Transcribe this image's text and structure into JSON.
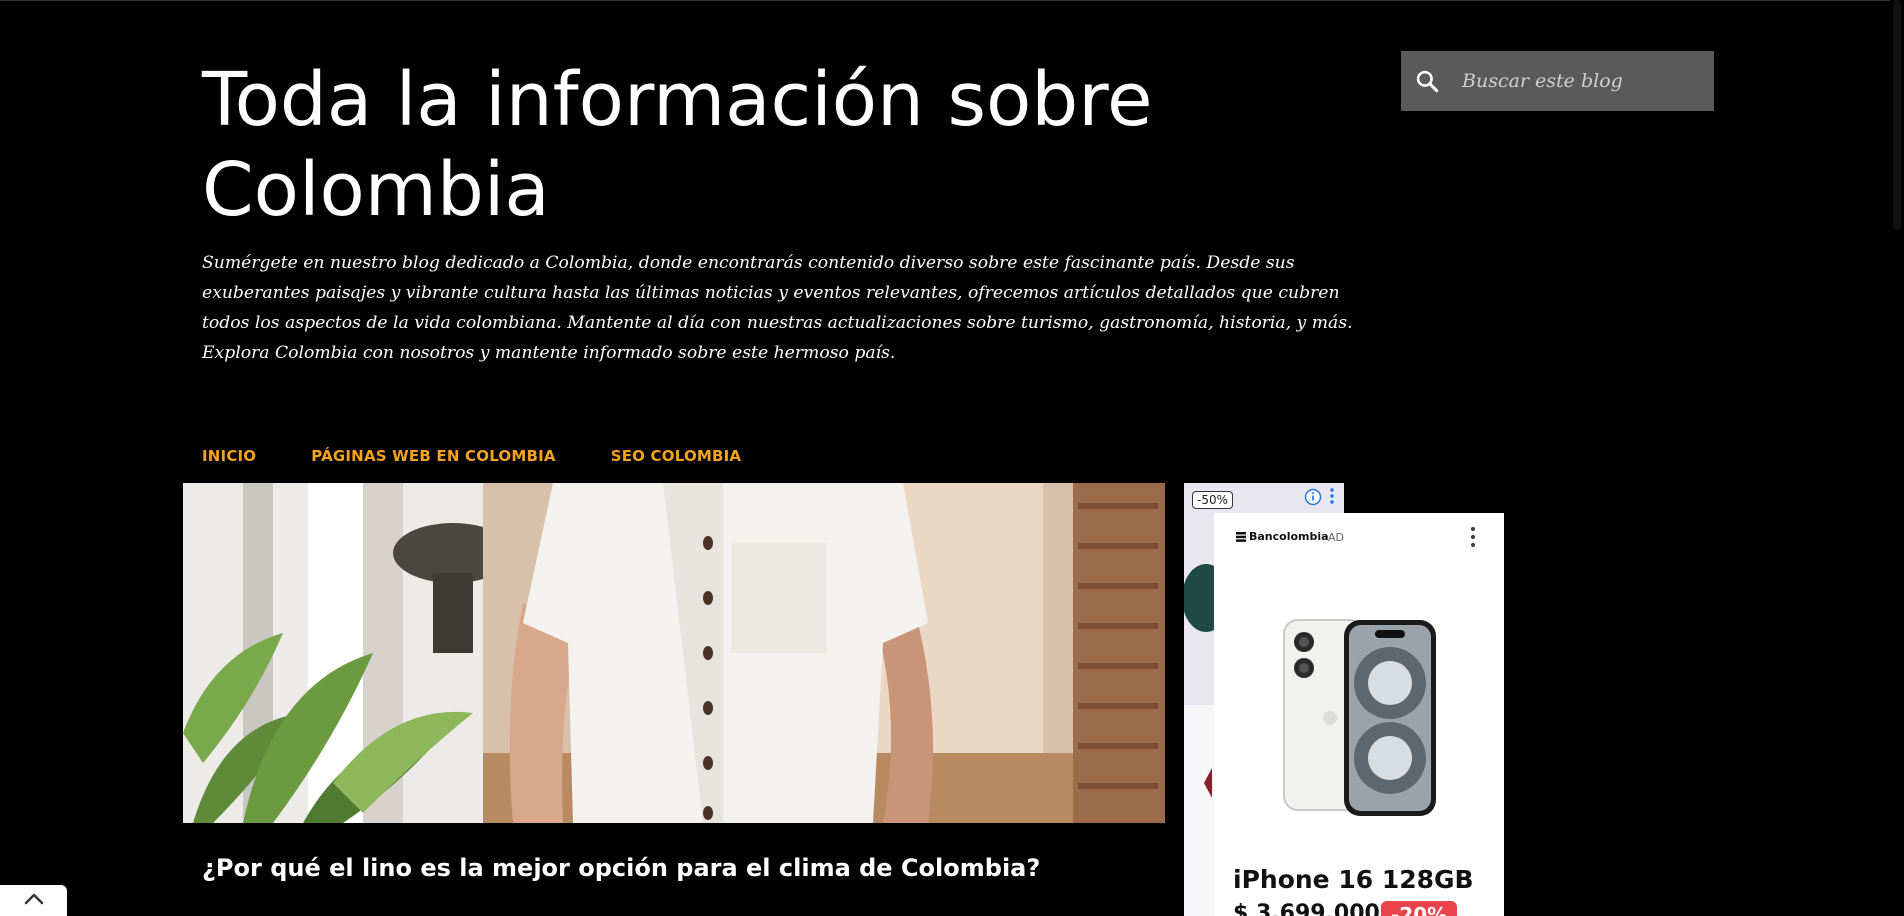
{
  "header": {
    "title": "Toda la información sobre Colombia",
    "description": "Sumérgete en nuestro blog dedicado a Colombia, donde encontrarás contenido diverso sobre este fascinante país. Desde sus exuberantes paisajes y vibrante cultura hasta las últimas noticias y eventos relevantes, ofrecemos artículos detallados que cubren todos los aspectos de la vida colombiana. Mantente al día con nuestras actualizaciones sobre turismo, gastronomía, historia, y más. Explora Colombia con nosotros y mantente informado sobre este hermoso país."
  },
  "search": {
    "placeholder": "Buscar este blog",
    "icon": "search-icon"
  },
  "nav": {
    "items": [
      {
        "label": "INICIO"
      },
      {
        "label": "PÁGINAS WEB EN COLOMBIA"
      },
      {
        "label": "SEO COLOMBIA"
      }
    ],
    "color": "#f5a31b"
  },
  "post": {
    "title": "¿Por qué el lino es la mejor opción para el clima de Colombia?"
  },
  "ad_back": {
    "discount_badge": "-50%",
    "info_icon": "info-icon",
    "menu_icon": "kebab-menu-icon"
  },
  "ad_front": {
    "brand": "Bancolombia",
    "ad_label": "AD",
    "product_name": "iPhone 16 128GB",
    "price": "$ 3.699.000",
    "discount": "-20%",
    "discount_color": "#e8434b"
  },
  "back_to_top": {
    "icon": "chevron-up-icon"
  }
}
